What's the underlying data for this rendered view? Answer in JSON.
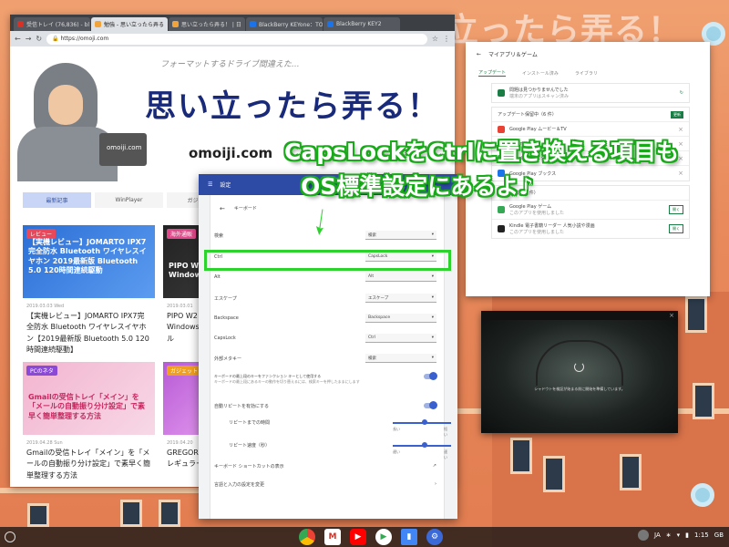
{
  "wallpaper": {
    "title": "思い立ったら弄る！"
  },
  "browser": {
    "tabs": [
      {
        "label": "受信トレイ (76,836) - bl",
        "color": "#d93025"
      },
      {
        "label": "勉強 - 思い立ったら弄る",
        "color": "#f2a33a"
      },
      {
        "label": "思い立ったら弄る！ | 日",
        "color": "#f2a33a"
      },
      {
        "label": "BlackBerry KEYone：TOI",
        "color": "#1a73e8"
      },
      {
        "label": "BlackBerry KEY2",
        "color": "#1a73e8"
      }
    ],
    "url": "https://omoji.com",
    "hero": {
      "sub": "フォーマットするドライブ間違えた...",
      "logo": "思い立ったら弄る！",
      "domain": "omoiji.com",
      "laptop_label": "omoiji.com"
    },
    "tabs2": [
      "最新記事",
      "WinPlayer",
      "ガジェット"
    ],
    "cards": [
      {
        "badge": "レビュー",
        "thumb": "【実機レビュー】JOMARTO IPX7完全防水 Bluetooth ワイヤレスイヤホン 2019最新版 Bluetooth 5.0 120時間連続駆動",
        "date": "2019.03.03 Wed",
        "text": "【実機レビュー】JOMARTO IPX7完全防水 Bluetooth ワイヤレスイヤホン【2019最新版 Bluetooth 5.0 120時間連続駆動】"
      },
      {
        "badge": "海外通販",
        "thumb": "PIPO W2 Windows",
        "date": "2019.03.01",
        "text": "PIPO W2 Windows 【100ドル"
      },
      {
        "badge": "PCのネタ",
        "thumb": "Gmailの受信トレイ「メイン」を「メールの自動振り分け設定」で素早く簡単整理する方法",
        "date": "2019.04.28 Sun",
        "text": "Gmailの受信トレイ「メイン」を「メールの自動振り分け設定」で素早く簡単整理する方法"
      },
      {
        "badge": "ガジェット",
        "thumb": "GREGOR",
        "date": "2019.04.20",
        "text": "GREGOR ナイロン レギュラー 】"
      }
    ]
  },
  "play": {
    "title": "マイアプリ＆ゲーム",
    "subtabs": [
      "アップデート",
      "インストール済み",
      "ライブラリ"
    ],
    "status": {
      "title": "問題は見つかりませんでした",
      "sub": "端末のアプリはスキャン済み"
    },
    "updates_header": "アップデート保留中（6 件）",
    "update_all": "更新",
    "apps": [
      {
        "name": "Google Play ムービー＆TV",
        "color": "#e94235"
      },
      {
        "name": "Chrome",
        "color": "#4285f4"
      },
      {
        "name": "Google アシスタント",
        "color": "#34a853"
      },
      {
        "name": "Google Play ブックス",
        "color": "#1a73e8"
      }
    ],
    "recent_header": "最近の更新（3 件）",
    "recent": [
      {
        "name": "Google Play ゲーム",
        "sub": "このアプリを使用しました",
        "btn": "開く"
      },
      {
        "name": "Kindle 電子書籍リーダー 人気小説や漫画",
        "sub": "このアプリを使用しました",
        "btn": "開く"
      }
    ]
  },
  "video": {
    "caption": "シャドウトを検証が始まる前に開始を準備しています。"
  },
  "settings": {
    "title": "設定",
    "page": "キーボード",
    "rows": [
      {
        "label": "検索",
        "value": "検索"
      },
      {
        "label": "Ctrl",
        "value": "CapsLock"
      },
      {
        "label": "Alt",
        "value": "Alt"
      },
      {
        "label": "エスケープ",
        "value": "エスケープ"
      },
      {
        "label": "Backspace",
        "value": "Backspace"
      },
      {
        "label": "CapsLock",
        "value": "Ctrl"
      },
      {
        "label": "外部メタキー",
        "value": "検索"
      }
    ],
    "fkeys_label": "キーボードの最上段のキーをファンクション キーとして使用する",
    "fkeys_sub": "キーボードの最上段にあるキーの動作を切り替えるには、検索キーを押したままにします",
    "repeat_label": "自動リピートを有効にする",
    "delay_label": "リピートまでの時間",
    "rate_label": "リピート速度（秒）",
    "long": "長い",
    "short": "短い",
    "slow": "遅い",
    "fast": "速い",
    "shortcuts": "キーボード ショートカットの表示",
    "input": "言語と入力の設定を変更"
  },
  "annotation": {
    "line1": "CapsLockをCtrlに置き換える項目も",
    "line2": "OS標準設定にあるよ♪"
  },
  "tray": {
    "ime": "JA",
    "time": "1:15",
    "gb": "GB"
  }
}
